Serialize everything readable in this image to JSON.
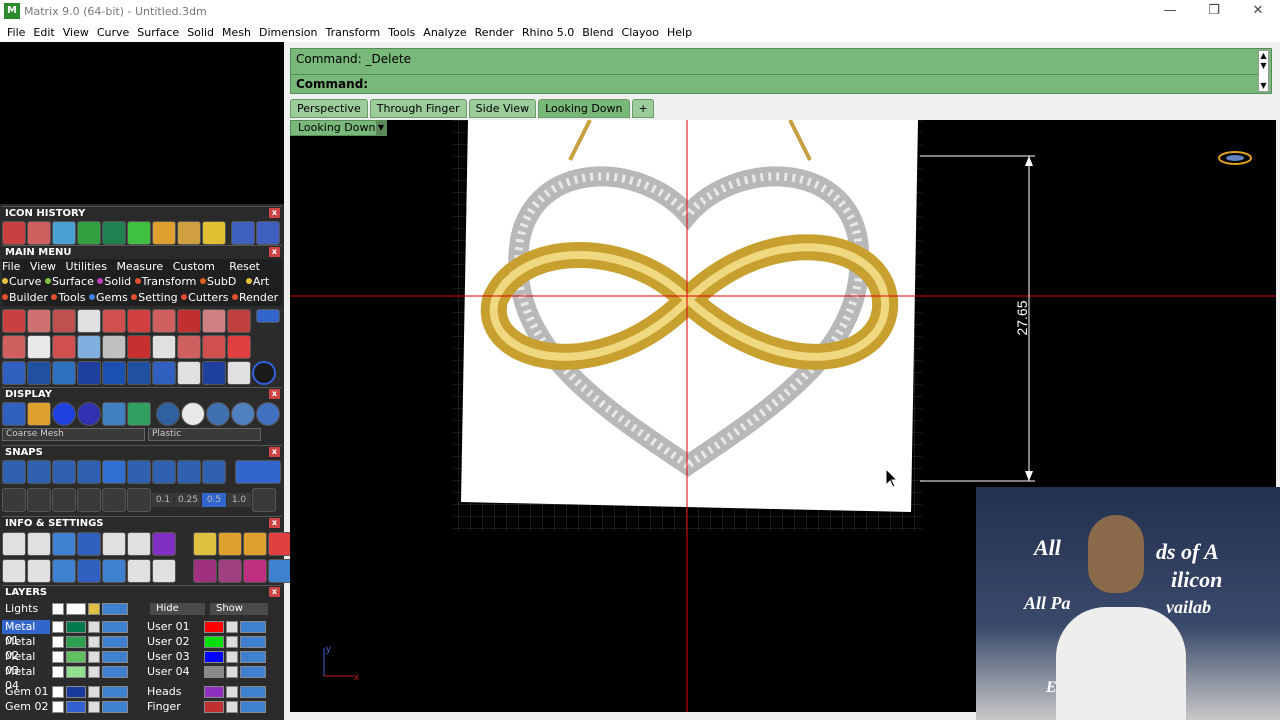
{
  "window": {
    "title": "Matrix 9.0 (64-bit) - Untitled.3dm",
    "min": "—",
    "restore": "❐",
    "close": "✕"
  },
  "menu": [
    "File",
    "Edit",
    "View",
    "Curve",
    "Surface",
    "Solid",
    "Mesh",
    "Dimension",
    "Transform",
    "Tools",
    "Analyze",
    "Render",
    "Rhino 5.0",
    "Blend",
    "Clayoo",
    "Help"
  ],
  "sections": {
    "icon_history": "ICON HISTORY",
    "main_menu": "MAIN MENU",
    "display": "DISPLAY",
    "snaps": "SNAPS",
    "info": "INFO & SETTINGS",
    "layers": "LAYERS"
  },
  "main_menu": {
    "items": [
      "File",
      "View",
      "Utilities",
      "Measure",
      "Custom"
    ],
    "reset": "Reset",
    "row1": [
      "Curve",
      "Surface",
      "Solid",
      "Transform",
      "SubD",
      "Art"
    ],
    "row2": [
      "Builder",
      "Tools",
      "Gems",
      "Setting",
      "Cutters",
      "Render"
    ],
    "row1_colors": [
      "#e8c040",
      "#80c040",
      "#c040c0",
      "#e05030",
      "#e06020",
      "#e8c040"
    ],
    "row2_colors": [
      "#e05030",
      "#e05030",
      "#4080e0",
      "#e05030",
      "#e05030",
      "#e05030"
    ]
  },
  "display": {
    "mesh": "Coarse Mesh",
    "material": "Plastic"
  },
  "snaps": {
    "values": [
      "0.1",
      "0.25",
      "0.5",
      "1.0"
    ]
  },
  "layers": {
    "lights": "Lights",
    "hide": "Hide",
    "show": "Show",
    "left": [
      {
        "name": "Metal 01",
        "color": "#007a4a",
        "selected": true
      },
      {
        "name": "Metal 02",
        "color": "#2aa050",
        "selected": false
      },
      {
        "name": "Metal 03",
        "color": "#60c060",
        "selected": false
      },
      {
        "name": "Metal 04",
        "color": "#90e090",
        "selected": false
      },
      {
        "name": "Gem 01",
        "color": "#1a3aa0",
        "selected": false
      },
      {
        "name": "Gem 02",
        "color": "#3060d0",
        "selected": false
      }
    ],
    "right": [
      {
        "name": "User 01",
        "color": "#ff0000"
      },
      {
        "name": "User 02",
        "color": "#00dd00"
      },
      {
        "name": "User 03",
        "color": "#0000ff"
      },
      {
        "name": "User 04",
        "color": "#888888"
      },
      {
        "name": "Heads",
        "color": "#9030c0"
      },
      {
        "name": "Finger",
        "color": "#c03030"
      }
    ]
  },
  "command": {
    "line1": "Command: _Delete",
    "line2": "Command:"
  },
  "tabs": [
    "Perspective",
    "Through Finger",
    "Side View",
    "Looking Down"
  ],
  "active_tab": "Looking Down",
  "viewport": {
    "name": "Looking Down",
    "dimension": "27.65",
    "axis_y": "y",
    "axis_x": "x"
  },
  "webcam": {
    "banner_line1": "All",
    "banner_line1b": "ds of A",
    "banner_line2": "ilicon",
    "banner_line3": "All Pa",
    "banner_line3b": "vailab",
    "banner_line4": "E"
  }
}
